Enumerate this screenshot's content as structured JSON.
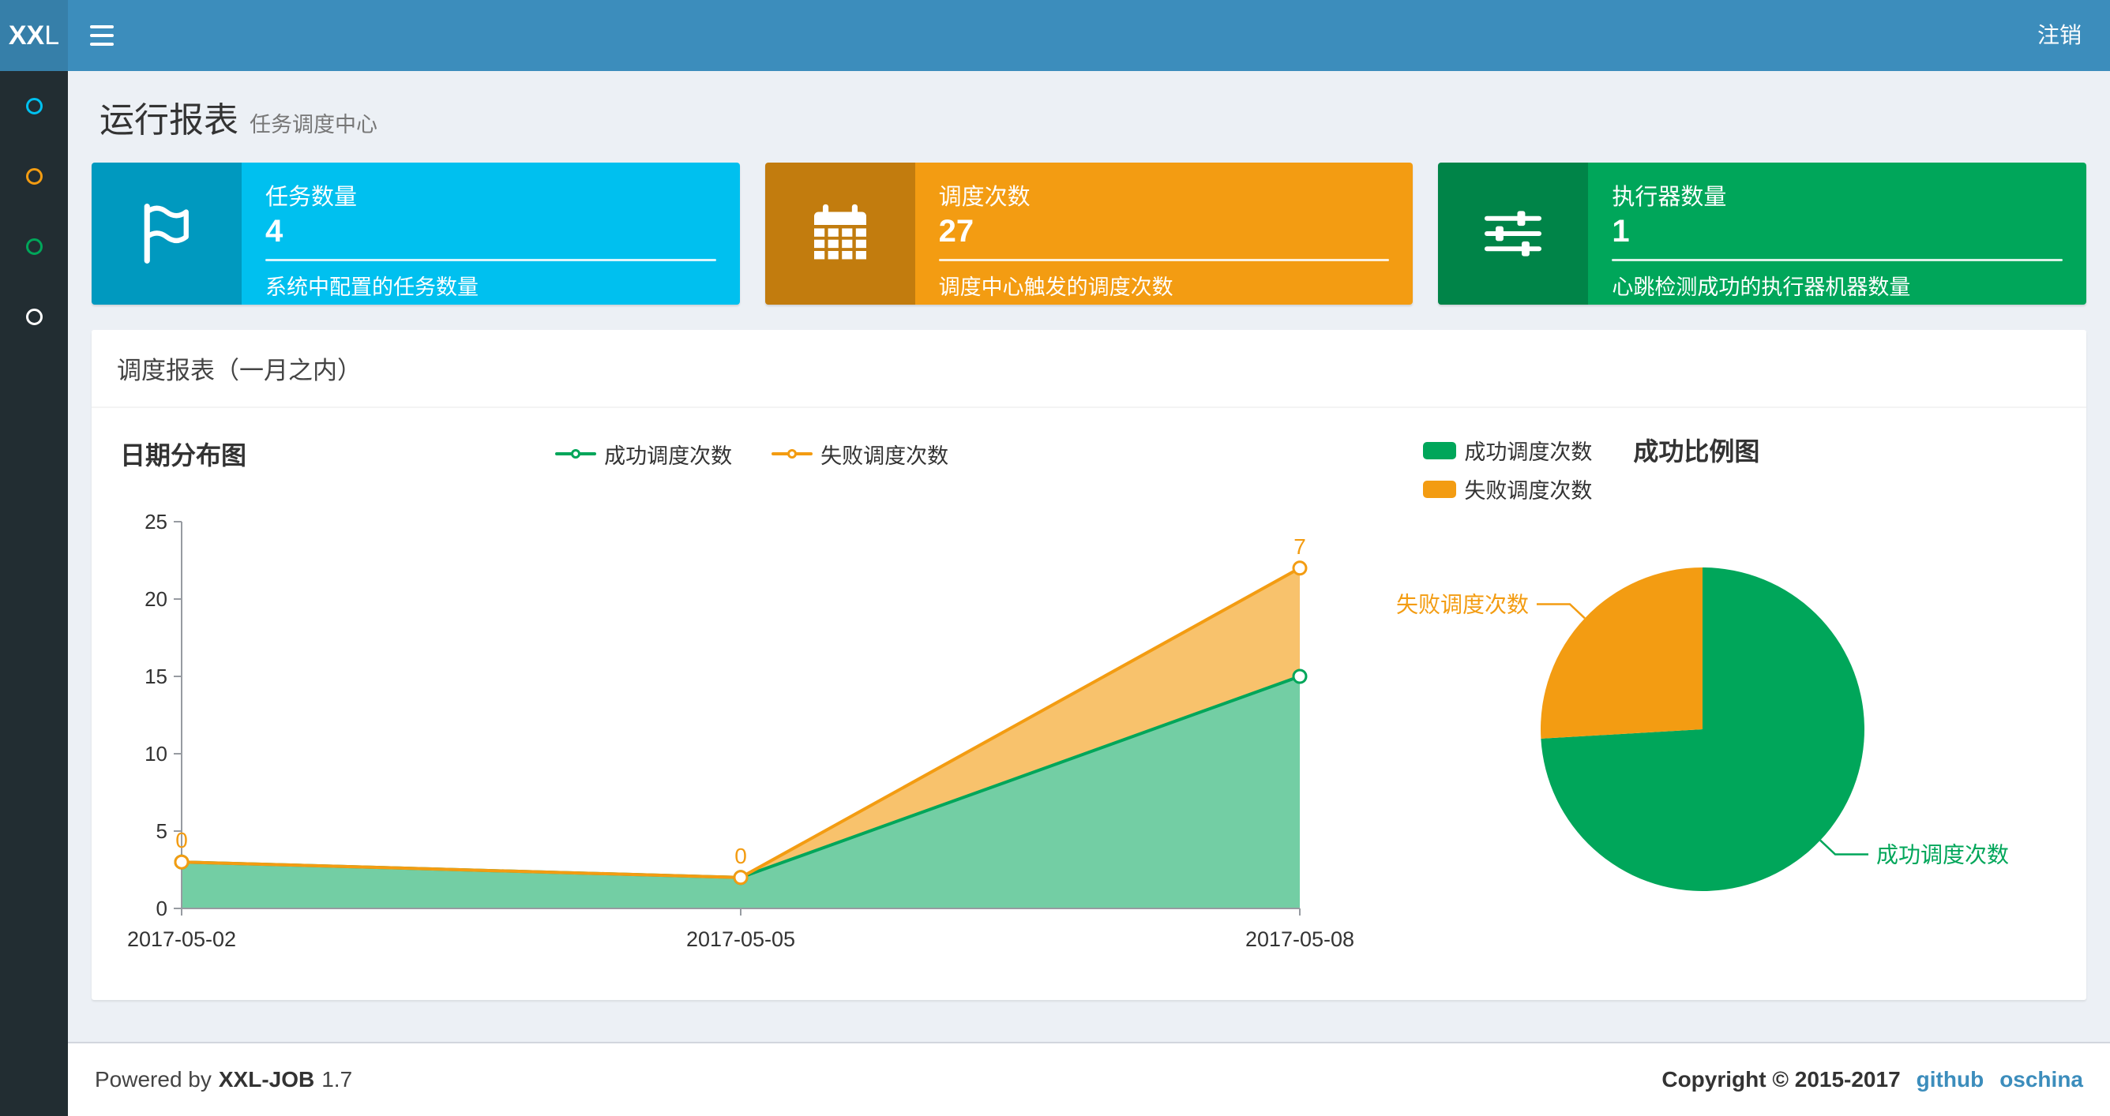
{
  "navbar": {
    "logo_bold": "XX",
    "logo_light": "L",
    "logout": "注销"
  },
  "sidebar": {
    "items": [
      {
        "icon": "circle-icon",
        "color": "#00c0ef"
      },
      {
        "icon": "circle-icon",
        "color": "#f39c12"
      },
      {
        "icon": "circle-icon",
        "color": "#00a65a"
      },
      {
        "icon": "circle-icon",
        "color": "#ffffff"
      }
    ]
  },
  "page_header": {
    "title": "运行报表",
    "subtitle": "任务调度中心"
  },
  "info_boxes": [
    {
      "label": "任务数量",
      "value": "4",
      "description": "系统中配置的任务数量",
      "color": "#00c0ef",
      "icon": "flag-icon"
    },
    {
      "label": "调度次数",
      "value": "27",
      "description": "调度中心触发的调度次数",
      "color": "#f39c12",
      "icon": "calendar-icon"
    },
    {
      "label": "执行器数量",
      "value": "1",
      "description": "心跳检测成功的执行器机器数量",
      "color": "#00a65a",
      "icon": "sliders-icon"
    }
  ],
  "panel": {
    "title": "调度报表（一月之内）"
  },
  "chart_data": [
    {
      "type": "area",
      "title": "日期分布图",
      "x": [
        "2017-05-02",
        "2017-05-05",
        "2017-05-08"
      ],
      "series": [
        {
          "name": "成功调度次数",
          "values": [
            3,
            2,
            15
          ],
          "color": "#00a65a"
        },
        {
          "name": "失败调度次数",
          "values": [
            0,
            0,
            7
          ],
          "color": "#f39c12"
        }
      ],
      "stacked": true,
      "ylim": [
        0,
        25
      ],
      "yticks": [
        0,
        5,
        10,
        15,
        20,
        25
      ],
      "legend_position": "top",
      "grid": false,
      "data_labels": {
        "series": "失败调度次数",
        "values": [
          0,
          0,
          7
        ]
      }
    },
    {
      "type": "pie",
      "title": "成功比例图",
      "slices": [
        {
          "name": "成功调度次数",
          "value": 20,
          "color": "#00a65a"
        },
        {
          "name": "失败调度次数",
          "value": 7,
          "color": "#f39c12"
        }
      ],
      "legend_position": "top-left"
    }
  ],
  "footer": {
    "powered_prefix": "Powered by",
    "app_name": "XXL-JOB",
    "version": "1.7",
    "copyright": "Copyright © 2015-2017",
    "links": [
      {
        "label": "github"
      },
      {
        "label": "oschina"
      }
    ]
  }
}
